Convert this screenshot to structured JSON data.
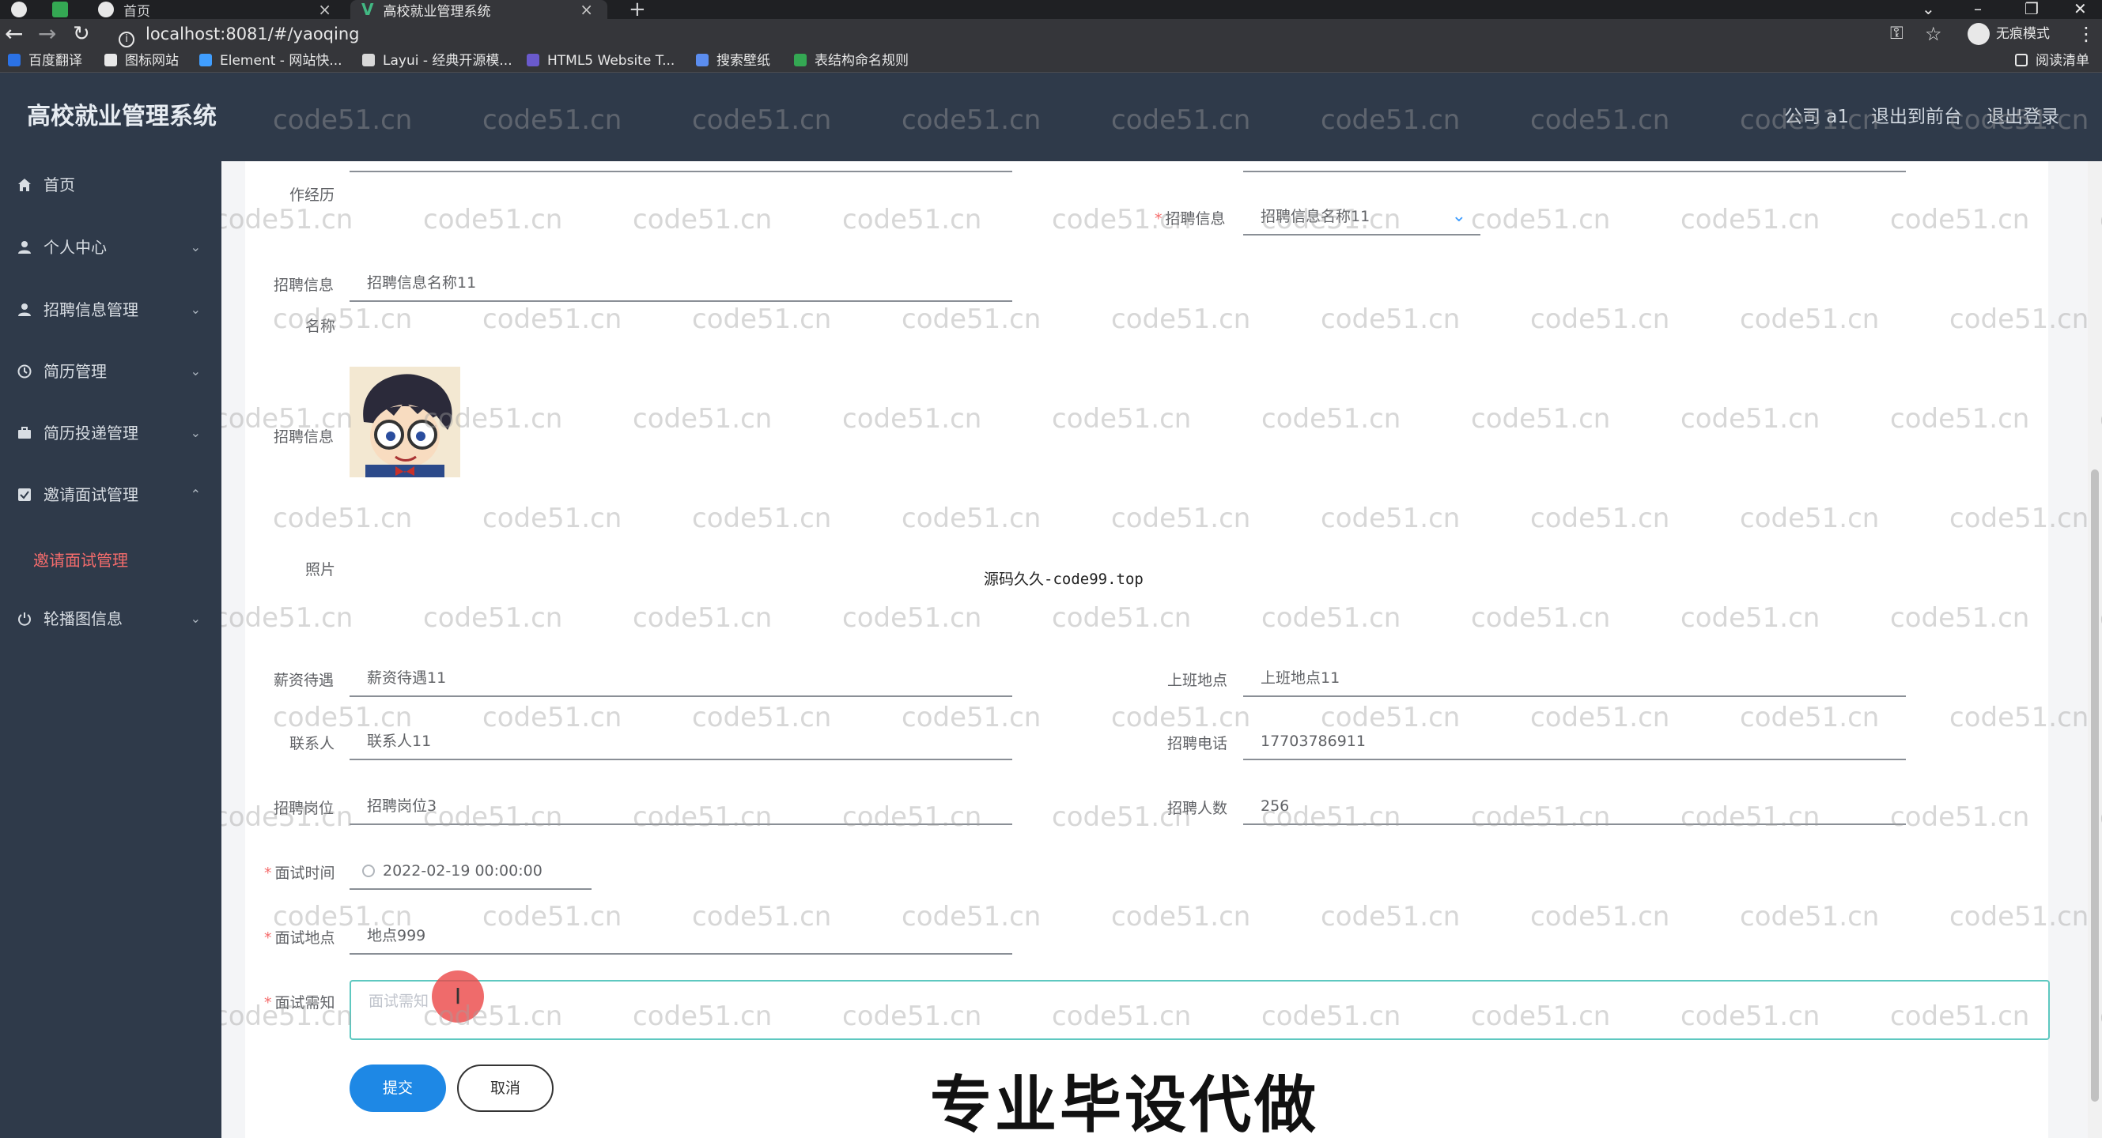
{
  "browser": {
    "tabs": [
      {
        "title": "首页",
        "active": false
      },
      {
        "title": "高校就业管理系统",
        "active": true
      }
    ],
    "new_tab": "+",
    "url": "localhost:8081/#/yaoqing",
    "incognito_label": "无痕模式",
    "bookmarks": [
      "百度翻译",
      "图标网站",
      "Element - 网站快...",
      "Layui - 经典开源模...",
      "HTML5 Website T...",
      "搜索壁纸",
      "表结构命名规则"
    ],
    "reading_list": "阅读清单"
  },
  "app": {
    "title": "高校就业管理系统",
    "header_links": [
      "公司 a1",
      "退出到前台",
      "退出登录"
    ]
  },
  "sidebar": {
    "items": [
      {
        "label": "首页",
        "icon": "home-icon"
      },
      {
        "label": "个人中心",
        "icon": "user-icon"
      },
      {
        "label": "招聘信息管理",
        "icon": "user-icon"
      },
      {
        "label": "简历管理",
        "icon": "clock-icon"
      },
      {
        "label": "简历投递管理",
        "icon": "briefcase-icon"
      },
      {
        "label": "邀请面试管理",
        "icon": "checkbox-icon",
        "expanded": true
      },
      {
        "label": "轮播图信息",
        "icon": "power-icon"
      }
    ],
    "active_sub": "邀请面试管理"
  },
  "form": {
    "work_history_label": "作经历",
    "recruit_info_label": "招聘信息",
    "recruit_info_value": "招聘信息名称11",
    "recruit_name_label_1": "招聘信息",
    "recruit_name_label_2": "名称",
    "recruit_name_value": "招聘信息名称11",
    "recruit_photo_label": "招聘信息",
    "photo_label": "照片",
    "salary_label": "薪资待遇",
    "salary_value": "薪资待遇11",
    "location_label": "上班地点",
    "location_value": "上班地点11",
    "contact_label": "联系人",
    "contact_value": "联系人11",
    "phone_label": "招聘电话",
    "phone_value": "17703786911",
    "position_label": "招聘岗位",
    "position_value": "招聘岗位3",
    "headcount_label": "招聘人数",
    "headcount_value": "256",
    "interview_time_label": "面试时间",
    "interview_time_value": "2022-02-19 00:00:00",
    "interview_place_label": "面试地点",
    "interview_place_value": "地点999",
    "interview_notice_label": "面试需知",
    "interview_notice_placeholder": "面试需知",
    "submit": "提交",
    "cancel": "取消"
  },
  "overlays": {
    "small_text": "源码久久-code99.top",
    "big_text": "专业毕设代做",
    "watermark": "code51.cn"
  }
}
